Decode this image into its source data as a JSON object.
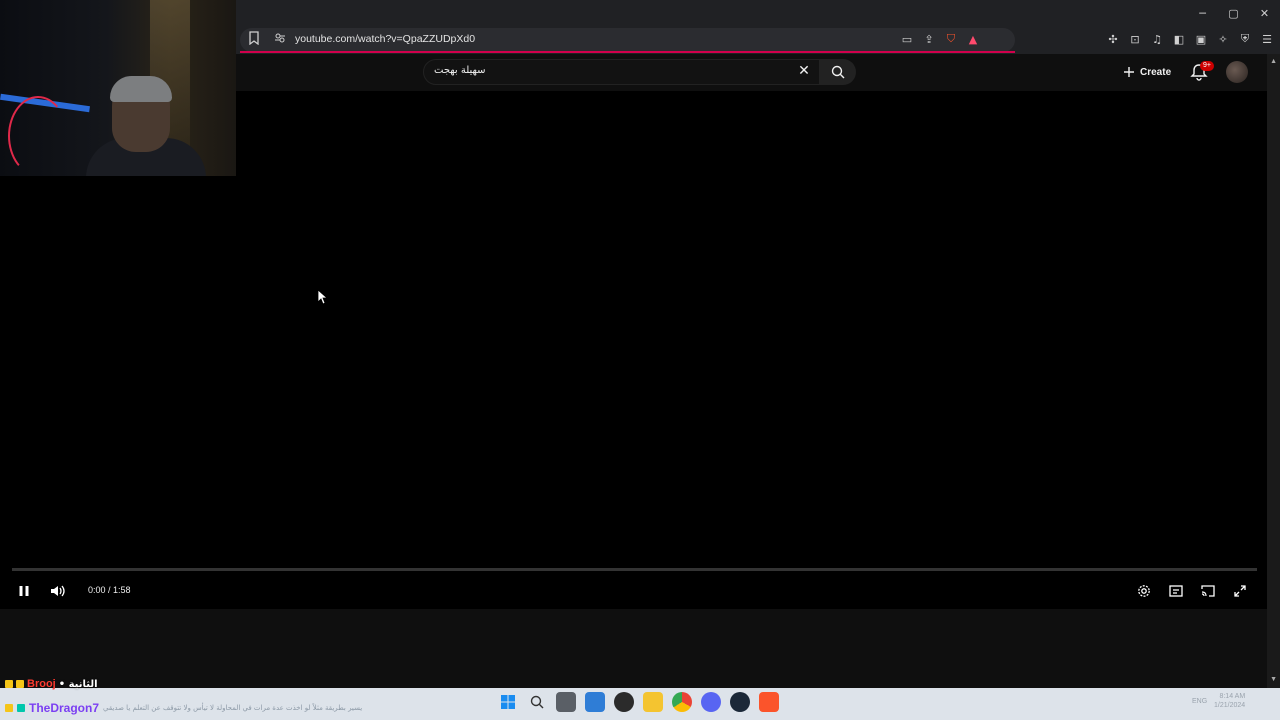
{
  "browser": {
    "url": "youtube.com/watch?v=QpaZZUDpXd0",
    "window_controls": {
      "minimize": "─",
      "maximize": "▢",
      "close": "✕"
    }
  },
  "youtube": {
    "search_value": "سهيلة بهجت",
    "create_label": "Create",
    "notification_badge": "9+"
  },
  "player": {
    "time": "0:00 / 1:58",
    "progress_fraction": 0.0
  },
  "chat": {
    "line1": {
      "user": "Brooj",
      "message": "• الثانية"
    },
    "line2": {
      "user": "TheDragon7",
      "message": "يسير بطريقة مثلاً لو اخذت عدة مرات في المحاولة لا تيأس ولا تتوقف عن التعلم يا صديقي"
    }
  },
  "taskbar": {
    "clock_time": "8:14 AM",
    "clock_date": "1/21/2024",
    "lang": "ENG"
  },
  "colors": {
    "accent_red": "#cc0000",
    "loading_bar": "#d1004c",
    "chat_user1": "#ff3b30",
    "chat_user2": "#7b3ff2"
  }
}
